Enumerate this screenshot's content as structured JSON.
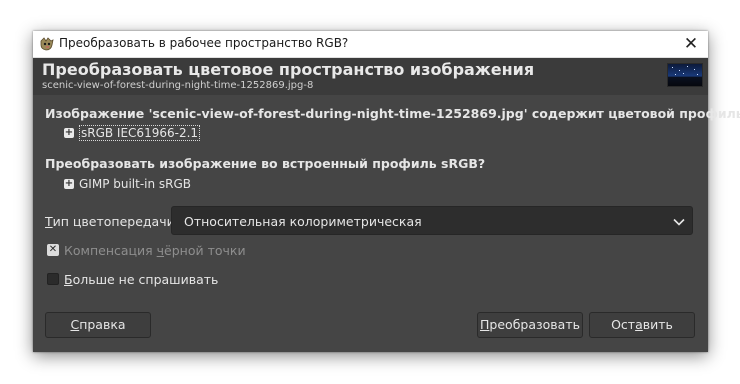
{
  "window": {
    "title": "Преобразовать в рабочее пространство RGB?",
    "close_glyph": "✕",
    "app_icon": "gimp-icon"
  },
  "header": {
    "title": "Преобразовать цветовое пространство изображения",
    "subtitle": "scenic-view-of-forest-during-night-time-1252869.jpg-8",
    "thumbnail": "image-thumbnail"
  },
  "body": {
    "profile_message": "Изображение 'scenic-view-of-forest-during-night-time-1252869.jpg' содержит цветовой профиль",
    "embedded_profile": "sRGB IEC61966-2.1",
    "convert_question": "Преобразовать изображение во встроенный профиль sRGB?",
    "builtin_profile": "GIMP built-in sRGB"
  },
  "intent": {
    "label_mnemonic": "Т",
    "label_rest": "ип цветопередачи:",
    "value": "Относительная колориметрическая"
  },
  "options": {
    "black_point": {
      "label_before": "Компенсация ",
      "label_mnemonic": "ч",
      "label_after": "ёрной точки",
      "checked": true,
      "enabled": false
    },
    "dont_ask": {
      "label_mnemonic": "Б",
      "label_rest": "ольше не спрашивать",
      "checked": false,
      "enabled": true
    }
  },
  "buttons": {
    "help": {
      "mnemonic": "С",
      "rest": "правка"
    },
    "convert": {
      "mnemonic": "П",
      "rest": "реобразовать"
    },
    "keep": {
      "before": "Ост",
      "mnemonic": "а",
      "after": "вить"
    }
  },
  "colors": {
    "dialog_bg": "#454545",
    "header_bg": "#3b3b3b",
    "text": "#e6e6e6",
    "disabled_text": "#8e8e8e"
  }
}
